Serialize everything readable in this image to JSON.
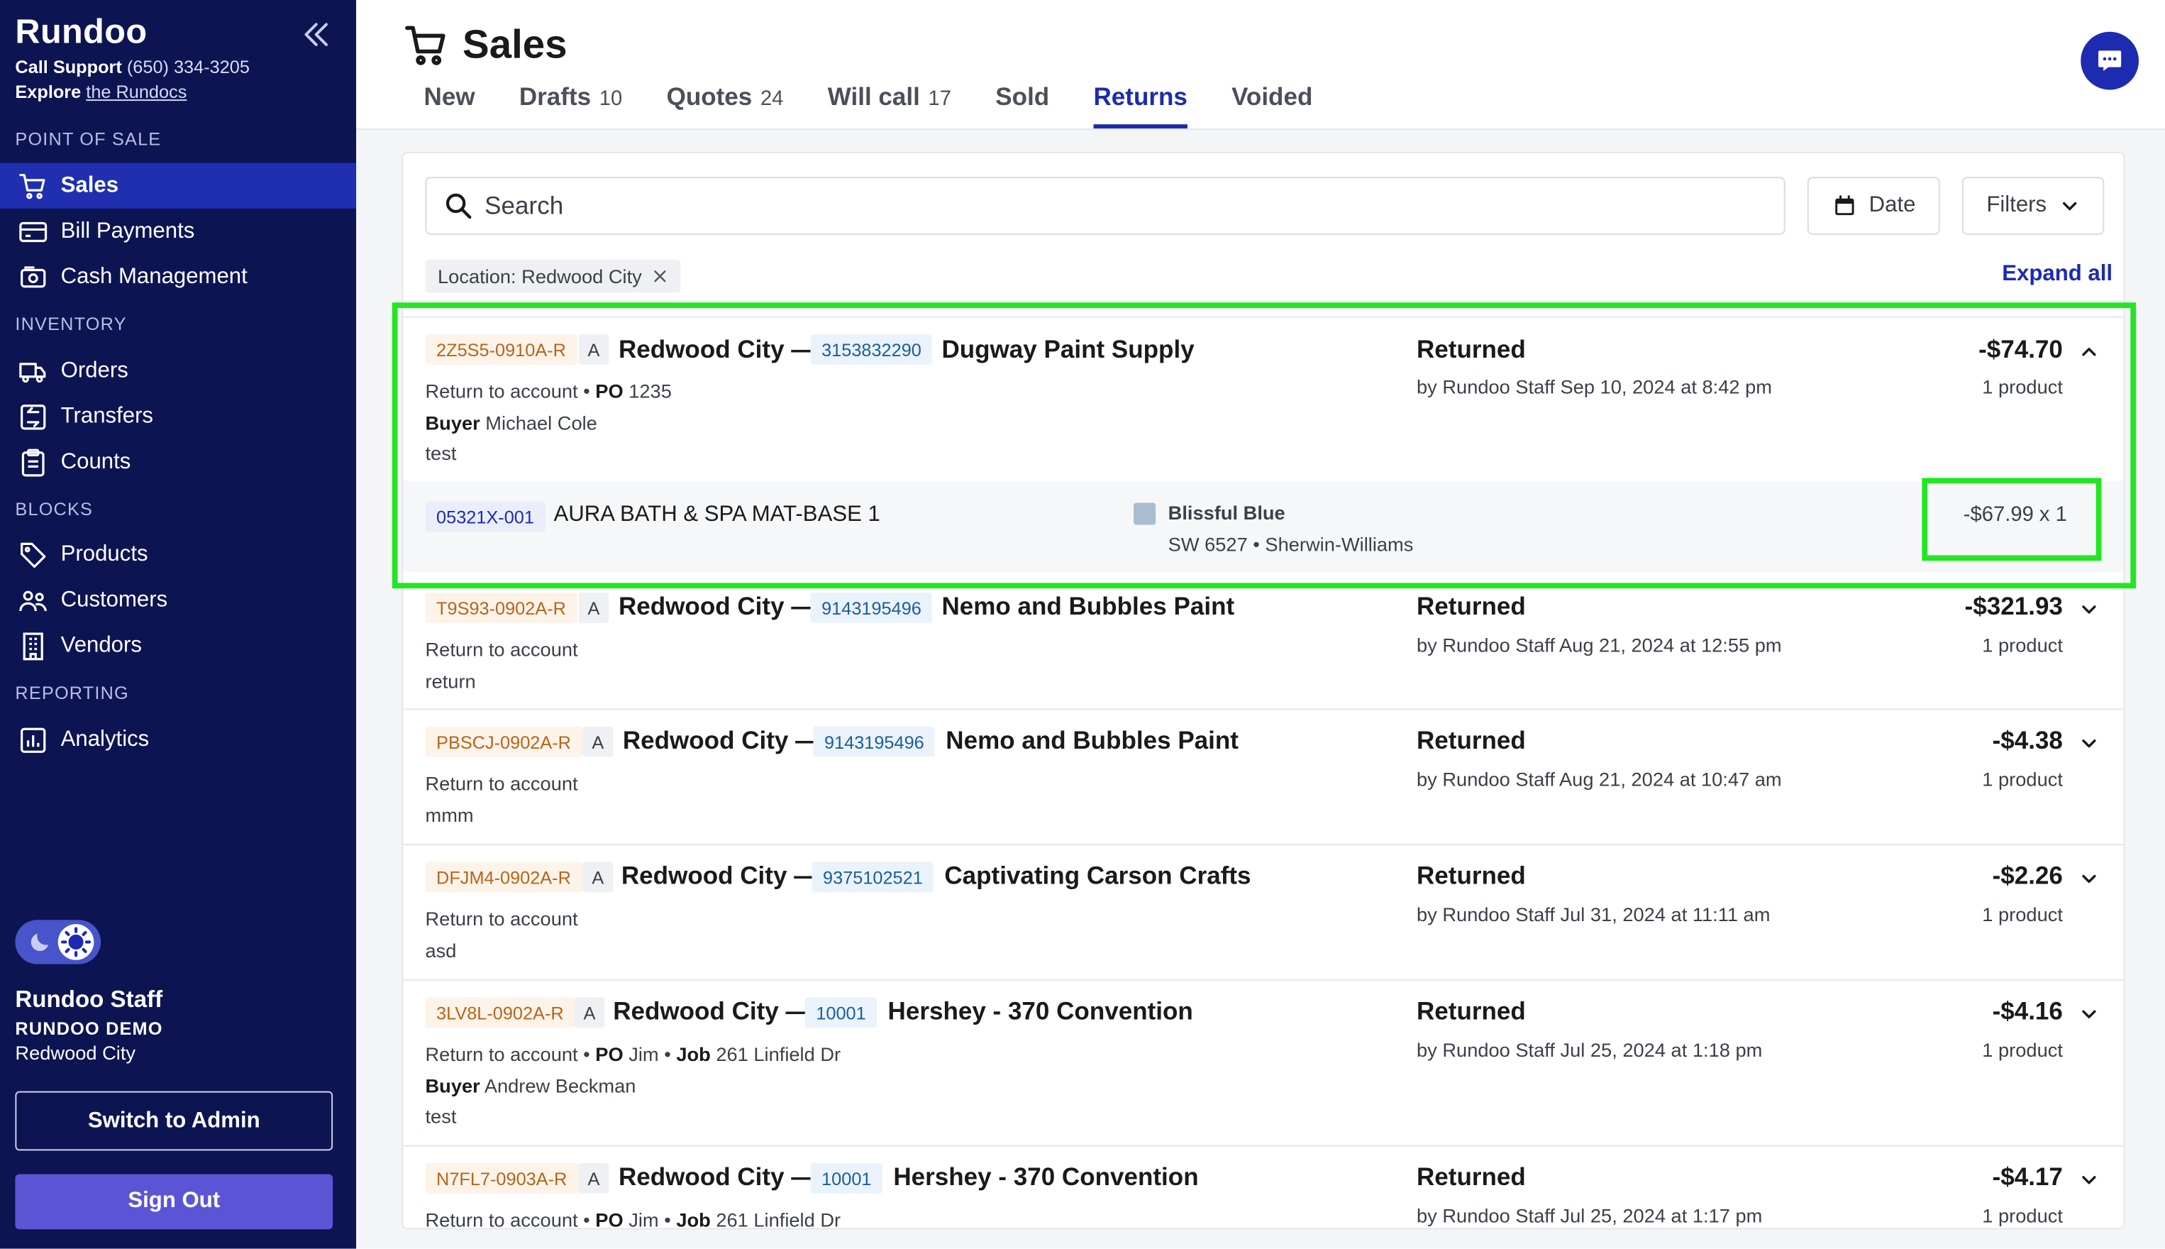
{
  "sidebar": {
    "brand": "Rundoo",
    "support_label": "Call Support",
    "support_phone": "(650) 334-3205",
    "explore_label": "Explore",
    "explore_link": "the Rundocs",
    "sections": {
      "pos": "POINT OF SALE",
      "inventory": "INVENTORY",
      "blocks": "BLOCKS",
      "reporting": "REPORTING"
    },
    "items": {
      "sales": "Sales",
      "bill_payments": "Bill Payments",
      "cash_management": "Cash Management",
      "orders": "Orders",
      "transfers": "Transfers",
      "counts": "Counts",
      "products": "Products",
      "customers": "Customers",
      "vendors": "Vendors",
      "analytics": "Analytics"
    },
    "user": {
      "name": "Rundoo Staff",
      "org": "RUNDOO DEMO",
      "city": "Redwood City"
    },
    "switch_admin": "Switch to Admin",
    "sign_out": "Sign Out"
  },
  "header": {
    "title": "Sales",
    "tabs": [
      {
        "label": "New",
        "count": ""
      },
      {
        "label": "Drafts",
        "count": "10"
      },
      {
        "label": "Quotes",
        "count": "24"
      },
      {
        "label": "Will call",
        "count": "17"
      },
      {
        "label": "Sold",
        "count": ""
      },
      {
        "label": "Returns",
        "count": ""
      },
      {
        "label": "Voided",
        "count": ""
      }
    ],
    "active_tab": "Returns"
  },
  "toolbar": {
    "search_placeholder": "Search",
    "date_label": "Date",
    "filters_label": "Filters",
    "chip_label": "Location: Redwood City",
    "expand_all": "Expand all"
  },
  "orders": [
    {
      "code": "2Z5S5-0910A-R",
      "tag": "A",
      "location": "Redwood City —",
      "account": "3153832290",
      "customer": "Dugway Paint Supply",
      "line1": "Return to account",
      "po_label": "PO",
      "po": "1235",
      "job_label": "",
      "job": "",
      "buyer_label": "Buyer",
      "buyer": "Michael Cole",
      "note": "test",
      "status": "Returned",
      "by": "by Rundoo Staff Sep 10, 2024 at 8:42 pm",
      "amount": "-$74.70",
      "products": "1 product",
      "expanded": true,
      "line_item": {
        "sku": "05321X-001",
        "name": "AURA BATH & SPA MAT-BASE 1",
        "color_name": "Blissful Blue",
        "color_code": "SW 6527 • Sherwin-Williams",
        "color_hex": "#a9bdd0",
        "price": "-$67.99 x 1"
      }
    },
    {
      "code": "T9S93-0902A-R",
      "tag": "A",
      "location": "Redwood City —",
      "account": "9143195496",
      "customer": "Nemo and Bubbles Paint",
      "line1": "Return to account",
      "note": "return",
      "status": "Returned",
      "by": "by Rundoo Staff Aug 21, 2024 at 12:55 pm",
      "amount": "-$321.93",
      "products": "1 product"
    },
    {
      "code": "PBSCJ-0902A-R",
      "tag": "A",
      "location": "Redwood City —",
      "account": "9143195496",
      "customer": "Nemo and Bubbles Paint",
      "line1": "Return to account",
      "note": "mmm",
      "status": "Returned",
      "by": "by Rundoo Staff Aug 21, 2024 at 10:47 am",
      "amount": "-$4.38",
      "products": "1 product"
    },
    {
      "code": "DFJM4-0902A-R",
      "tag": "A",
      "location": "Redwood City —",
      "account": "9375102521",
      "customer": "Captivating Carson Crafts",
      "line1": "Return to account",
      "note": "asd",
      "status": "Returned",
      "by": "by Rundoo Staff Jul 31, 2024 at 11:11 am",
      "amount": "-$2.26",
      "products": "1 product"
    },
    {
      "code": "3LV8L-0902A-R",
      "tag": "A",
      "location": "Redwood City —",
      "account": "10001",
      "customer": "Hershey - 370 Convention",
      "line1": "Return to account",
      "po_label": "PO",
      "po": "Jim",
      "job_label": "Job",
      "job": "261 Linfield Dr",
      "buyer_label": "Buyer",
      "buyer": "Andrew Beckman",
      "note": "test",
      "status": "Returned",
      "by": "by Rundoo Staff Jul 25, 2024 at 1:18 pm",
      "amount": "-$4.16",
      "products": "1 product"
    },
    {
      "code": "N7FL7-0903A-R",
      "tag": "A",
      "location": "Redwood City —",
      "account": "10001",
      "customer": "Hershey - 370 Convention",
      "line1": "Return to account",
      "po_label": "PO",
      "po": "Jim",
      "job_label": "Job",
      "job": "261 Linfield Dr",
      "status": "Returned",
      "by": "by Rundoo Staff Jul 25, 2024 at 1:17 pm",
      "amount": "-$4.17",
      "products": "1 product"
    }
  ],
  "colors": {
    "sidebar_bg": "#0d1452",
    "accent": "#1c2bb0",
    "highlight": "#22e622",
    "sign_out_bg": "#5b55d6"
  }
}
